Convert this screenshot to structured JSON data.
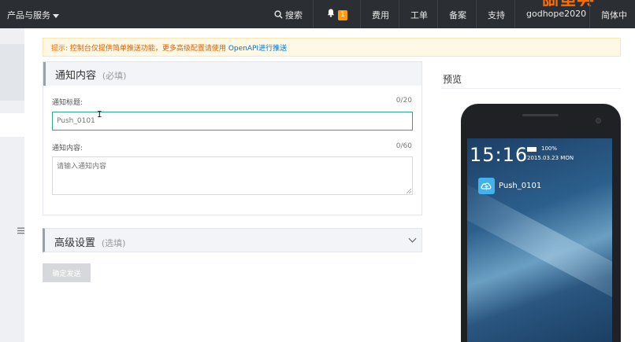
{
  "topbar": {
    "menu_label": "产品与服务",
    "search_label": "搜索",
    "notification_count": "1",
    "billing_label": "费用",
    "tickets_label": "工单",
    "icp_label": "备案",
    "support_label": "支持",
    "username": "godhope2020",
    "language_label": "简体中",
    "logo_text": "阿里云"
  },
  "tip": {
    "label": "提示:",
    "text": "控制台仅提供简单推送功能，更多高级配置请使用",
    "link": "OpenAPI进行推送"
  },
  "notice_panel": {
    "title": "通知内容",
    "hint": "(必填)",
    "title_field": {
      "label": "通知标题:",
      "count": "0/20",
      "value": "Push_0101"
    },
    "content_field": {
      "label": "通知内容:",
      "count": "0/60",
      "placeholder": "请输入通知内容"
    }
  },
  "advanced": {
    "title": "高级设置",
    "hint": "(选填)"
  },
  "confirm_button": "确定发送",
  "preview": {
    "title": "预览",
    "clock": "15:16",
    "battery": "100%",
    "date": "2015.03.23 MON",
    "notification_title": "Push_0101"
  },
  "colors": {
    "topbar_bg": "#2b2f33",
    "accent_orange": "#ff6a00",
    "input_focus": "#2fa58d",
    "link_blue": "#0070cc"
  }
}
